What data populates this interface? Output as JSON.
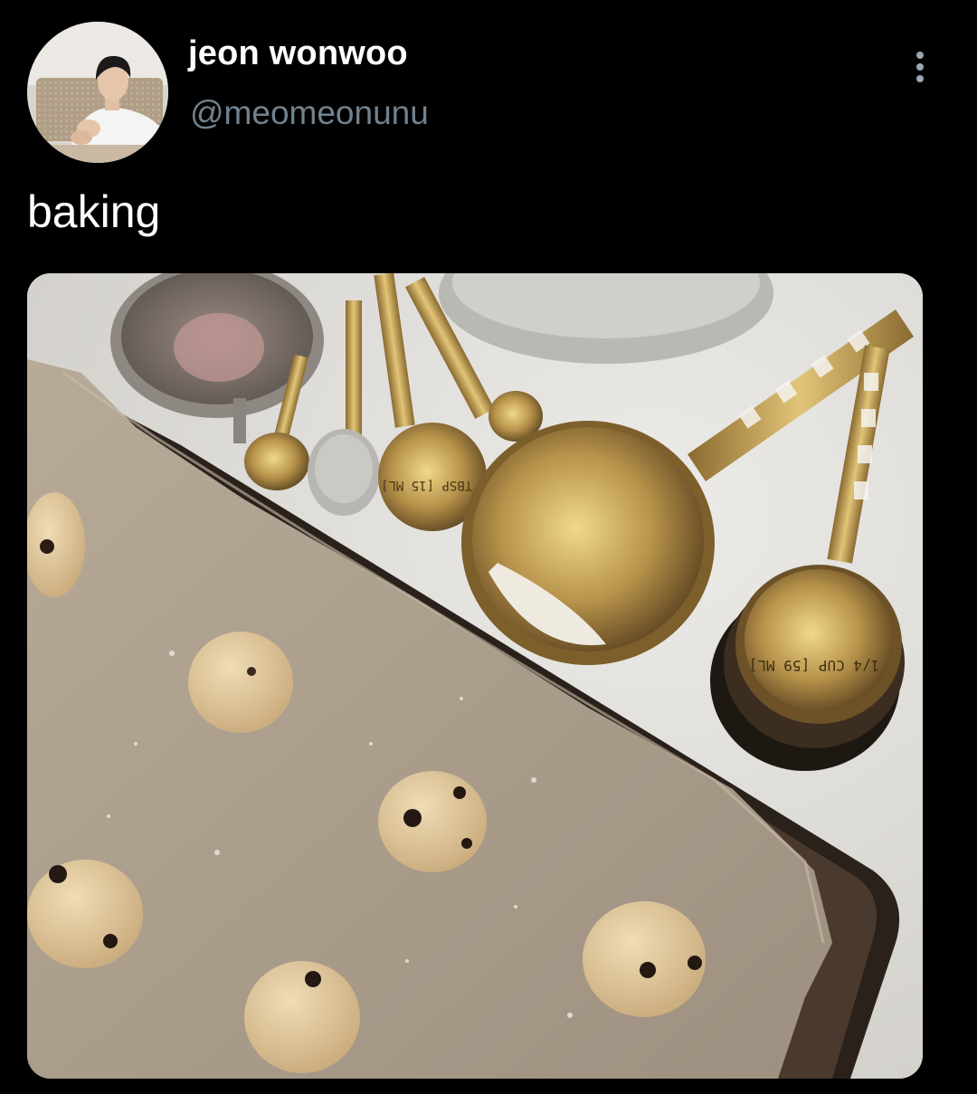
{
  "tweet": {
    "author": {
      "display_name": "jeon wonwoo",
      "handle": "@meomeonunu",
      "avatar_icon": "profile-photo"
    },
    "text": "baking",
    "more_icon": "vertical-ellipsis-icon",
    "media": {
      "kind": "photo",
      "engraved_labels": [
        "1 TBSP [15 ML]",
        "1/4 CUP [59 ML]"
      ]
    }
  },
  "colors": {
    "background": "#000000",
    "primary_text": "#ffffff",
    "secondary_text": "#71828f",
    "icon": "#9aa6b1"
  }
}
